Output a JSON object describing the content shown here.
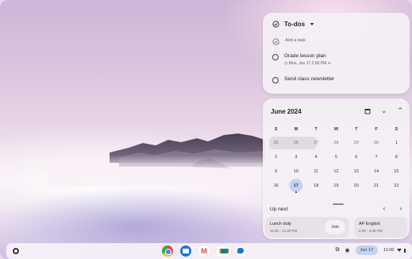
{
  "todo": {
    "title": "To-dos",
    "add_task": "Add a task",
    "tasks": [
      {
        "label": "Grade lesson plan",
        "due": "Mon, Jun 17 2:00 PM"
      },
      {
        "label": "Send class newsletter"
      }
    ]
  },
  "calendar": {
    "month_label": "June 2024",
    "weekdays": [
      "S",
      "M",
      "T",
      "W",
      "T",
      "F",
      "S"
    ],
    "weeks": [
      [
        "26",
        "26",
        "27",
        "28",
        "29",
        "30",
        "1"
      ],
      [
        "2",
        "3",
        "4",
        "5",
        "6",
        "7",
        "8"
      ],
      [
        "9",
        "10",
        "11",
        "12",
        "13",
        "14",
        "15"
      ],
      [
        "16",
        "17",
        "18",
        "19",
        "20",
        "21",
        "22"
      ]
    ],
    "today": "17",
    "up_next_label": "Up next",
    "events": [
      {
        "title": "Lunch duty",
        "time": "11:30 - 12:30 PM",
        "action": "Join"
      },
      {
        "title": "AP English",
        "time": "2:30 - 4:30 PM"
      }
    ]
  },
  "shelf": {
    "apps": [
      "chrome-icon",
      "files-icon",
      "gmail-icon",
      "meet-icon",
      "chat-icon"
    ],
    "date": "Jun 17",
    "time": "11:00"
  },
  "colors": {
    "today_highlight": "#c6d2ee",
    "panel_bg": "#f4f0f5"
  }
}
